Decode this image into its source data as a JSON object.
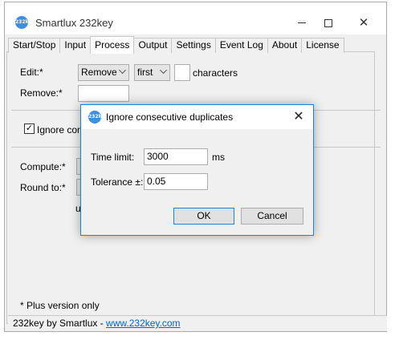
{
  "window": {
    "title": "Smartlux 232key",
    "icon_text": "232key",
    "controls": {
      "minimize": "minimize",
      "maximize": "maximize",
      "close": "✕"
    }
  },
  "tabs": [
    {
      "label": "Start/Stop",
      "active": false
    },
    {
      "label": "Input",
      "active": false
    },
    {
      "label": "Process",
      "active": true
    },
    {
      "label": "Output",
      "active": false
    },
    {
      "label": "Settings",
      "active": false
    },
    {
      "label": "Event Log",
      "active": false
    },
    {
      "label": "About",
      "active": false
    },
    {
      "label": "License",
      "active": false
    }
  ],
  "process": {
    "edit_label": "Edit:*",
    "edit_action": "Remove",
    "edit_position": "first",
    "edit_count": "",
    "characters_label": "characters",
    "remove_label": "Remove:*",
    "remove_value": "",
    "ignore_label_visible": "Ignore cons",
    "ignore_checked": true,
    "compute_label": "Compute:*",
    "round_label": "Round to:*",
    "partial_text": "u",
    "plus_note": "* Plus version only"
  },
  "status": {
    "prefix": "232key by Smartlux - ",
    "link": "www.232key.com"
  },
  "dialog": {
    "title": "Ignore consecutive duplicates",
    "close": "✕",
    "time_limit_label": "Time limit:",
    "time_limit_value": "3000",
    "time_unit": "ms",
    "tolerance_label": "Tolerance ±:",
    "tolerance_value": "0.05",
    "ok_label": "OK",
    "cancel_label": "Cancel"
  },
  "colors": {
    "accent": "#1883d7",
    "link": "#0066cc",
    "icon": "#3d8fe0"
  }
}
